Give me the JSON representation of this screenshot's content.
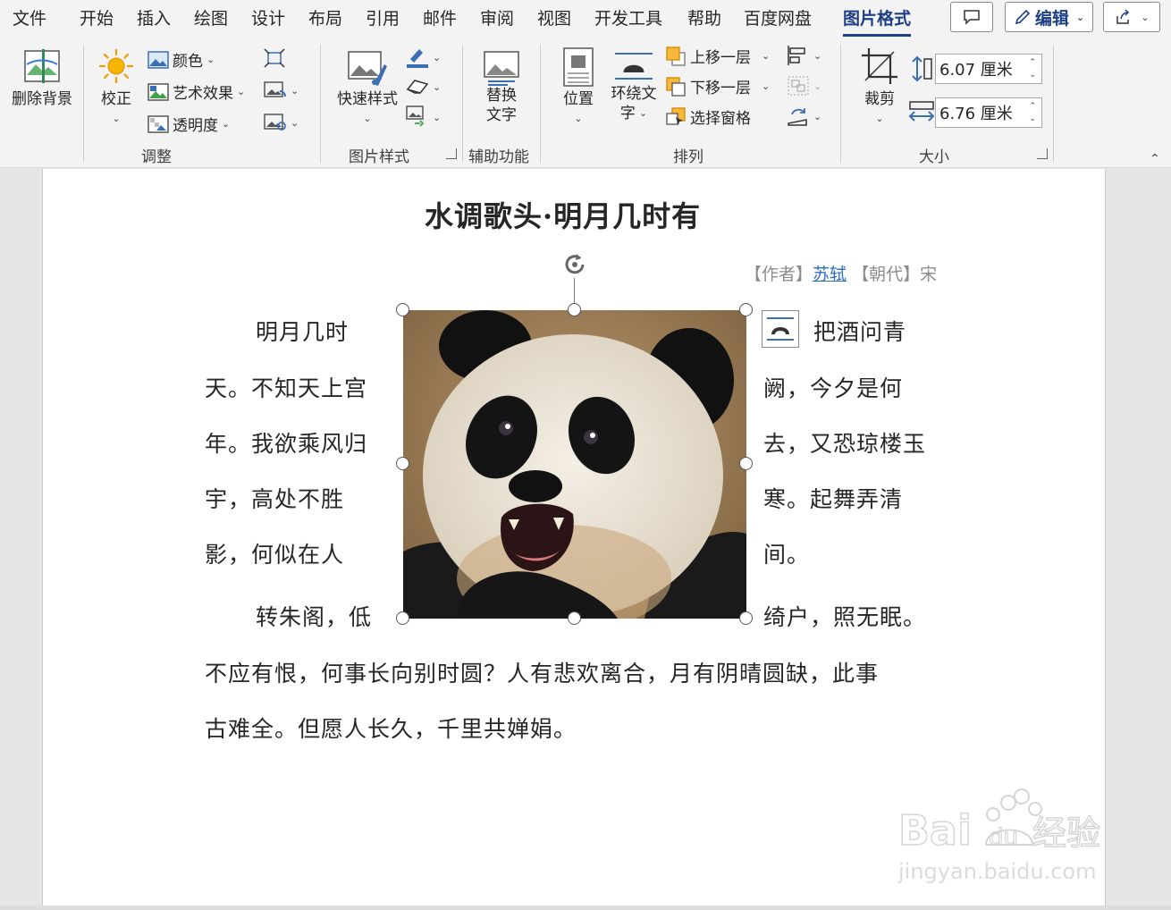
{
  "tabs": [
    "文件",
    "开始",
    "插入",
    "绘图",
    "设计",
    "布局",
    "引用",
    "邮件",
    "审阅",
    "视图",
    "开发工具",
    "帮助",
    "百度网盘",
    "图片格式"
  ],
  "topbar": {
    "edit_label": "编辑"
  },
  "ribbon": {
    "remove_bg": "删除背景",
    "correct": "校正",
    "color": "颜色",
    "art_effects": "艺术效果",
    "transparency": "透明度",
    "quick_styles": "快速样式",
    "alt_text": [
      "替换",
      "文字"
    ],
    "position": "位置",
    "wrap_text": [
      "环绕文",
      "字"
    ],
    "bring_forward": "上移一层",
    "send_backward": "下移一层",
    "selection_pane": "选择窗格",
    "crop": "裁剪",
    "height": "6.07 厘米",
    "width": "6.76 厘米",
    "groups": {
      "adjust": "调整",
      "picture_styles": "图片样式",
      "accessibility": "辅助功能",
      "arrange": "排列",
      "size": "大小"
    }
  },
  "document": {
    "title": "水调歌头·明月几时有",
    "meta": {
      "author_label": "【作者】",
      "author": "苏轼",
      "dynasty_label": "【朝代】",
      "dynasty": "宋"
    },
    "left_lines": [
      "明月几时",
      "天。不知天上宫",
      "年。我欲乘风归",
      "宇，高处不胜",
      "影，何似在人",
      "转朱阁，低"
    ],
    "right_lines": [
      "把酒问青",
      "阙，今夕是何",
      "去，又恐琼楼玉",
      "寒。起舞弄清",
      "间。",
      "绮户，照无眠。"
    ],
    "full_lines": [
      "不应有恨，何事长向别时圆？人有悲欢离合，月有阴晴圆缺，此事",
      "古难全。但愿人长久，千里共婵娟。"
    ]
  },
  "colors": {
    "accent": "#1e3f86",
    "link": "#2f6fbe",
    "ribbon_bg": "#f3f3f3"
  }
}
